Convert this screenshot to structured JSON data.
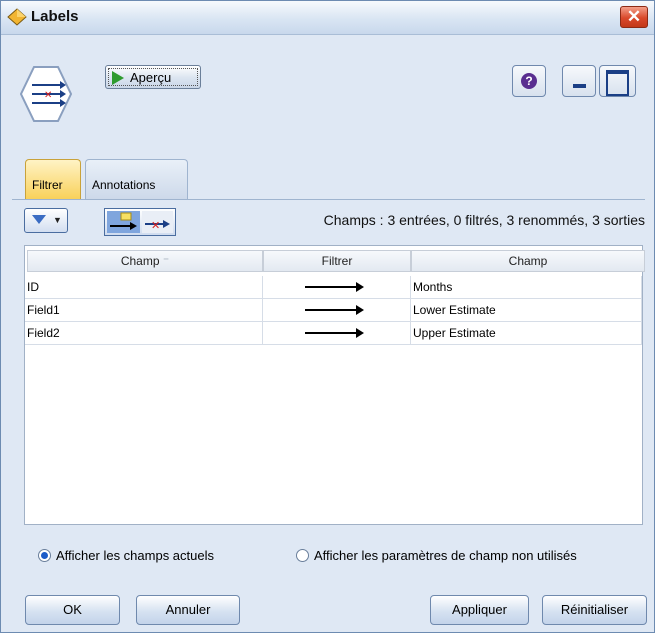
{
  "window": {
    "title": "Labels",
    "close_glyph": "✕"
  },
  "toolbar": {
    "preview_label": "Aperçu",
    "help_glyph": "?"
  },
  "tabs": [
    {
      "label": "Filtrer",
      "active": true
    },
    {
      "label": "Annotations",
      "active": false
    }
  ],
  "filter": {
    "summary": "Champs : 3 entrées, 0 filtrés, 3 renommés, 3 sorties",
    "columns": [
      "Champ",
      "Filtrer",
      "Champ"
    ],
    "sort_glyph": "⁻",
    "rows": [
      {
        "input": "ID",
        "output": "Months"
      },
      {
        "input": "Field1",
        "output": "Lower Estimate"
      },
      {
        "input": "Field2",
        "output": "Upper Estimate"
      }
    ],
    "radio_current": "Afficher les champs actuels",
    "radio_unused": "Afficher les paramètres de champ non utilisés"
  },
  "buttons": {
    "ok": "OK",
    "cancel": "Annuler",
    "apply": "Appliquer",
    "reset": "Réinitialiser"
  },
  "colors": {
    "accent": "#1b5bc8",
    "tab_active": "#f9d15a"
  }
}
